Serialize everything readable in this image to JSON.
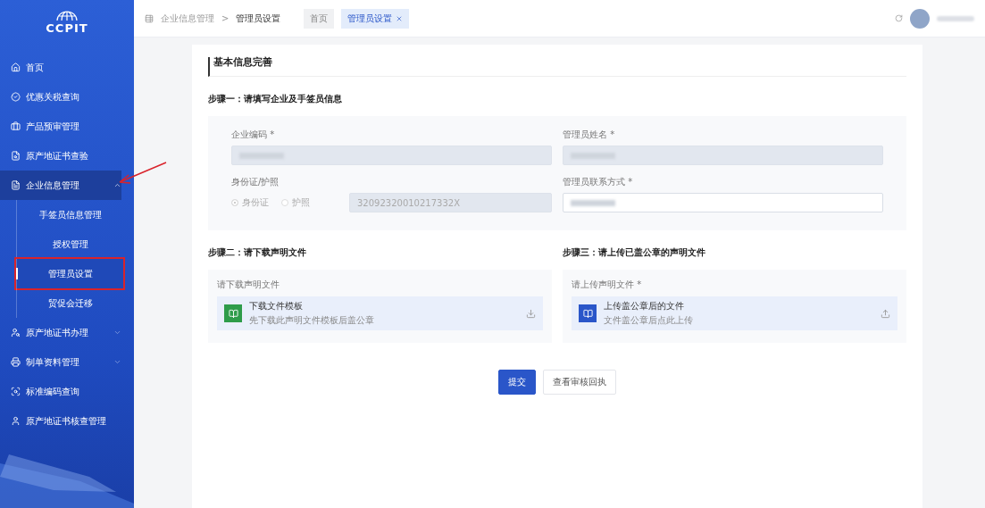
{
  "sidebar": {
    "logo": "CCPIT",
    "items": [
      {
        "label": "首页",
        "selected": false
      },
      {
        "label": "优惠关税查询",
        "selected": false
      },
      {
        "label": "产品预审管理",
        "selected": false
      },
      {
        "label": "原产地证书查验",
        "selected": false
      },
      {
        "label": "企业信息管理",
        "selected": false,
        "expanded": true,
        "children": [
          {
            "label": "手签员信息管理",
            "selected": false
          },
          {
            "label": "授权管理",
            "selected": false
          },
          {
            "label": "管理员设置",
            "selected": true
          },
          {
            "label": "贸促会迁移",
            "selected": false
          }
        ]
      },
      {
        "label": "原产地证书办理",
        "selected": false,
        "expanded": false
      },
      {
        "label": "制单资料管理",
        "selected": false,
        "expanded": false
      },
      {
        "label": "标准编码查询",
        "selected": false
      },
      {
        "label": "原产地证书核查管理",
        "selected": false
      }
    ]
  },
  "topbar": {
    "breadcrumb": [
      "企业信息管理",
      "管理员设置"
    ],
    "separator": ">",
    "tabs": [
      {
        "label": "首页",
        "selected": false,
        "closable": false
      },
      {
        "label": "管理员设置",
        "selected": true,
        "closable": true
      }
    ]
  },
  "form": {
    "title": "基本信息完善",
    "step1": {
      "title": "步骤一：请填写企业及手签员信息",
      "fields": [
        {
          "label": "企业编码 *",
          "kind": "text",
          "disabled": true
        },
        {
          "label": "管理员姓名 *",
          "kind": "text",
          "disabled": true
        },
        {
          "label": "身份证/护照",
          "kind": "id",
          "options": [
            {
              "label": "身份证",
              "selected": true
            },
            {
              "label": "护照",
              "selected": false
            }
          ],
          "value": "32092320010217332X",
          "disabled": true
        },
        {
          "label": "管理员联系方式 *",
          "kind": "text",
          "disabled": false
        }
      ]
    },
    "step2": {
      "title": "步骤二：请下载声明文件",
      "label": "请下载声明文件",
      "file_title": "下载文件模板",
      "file_hint": "先下载此声明文件模板后盖公章",
      "kind": "download"
    },
    "step3": {
      "title": "步骤三：请上传已盖公章的声明文件",
      "label": "请上传声明文件 *",
      "file_title": "上传盖公章后的文件",
      "file_hint": "文件盖公章后点此上传",
      "kind": "upload"
    },
    "buttons": [
      {
        "label": "提交",
        "kind": "primary"
      },
      {
        "label": "查看审核回执",
        "kind": "default"
      }
    ]
  }
}
